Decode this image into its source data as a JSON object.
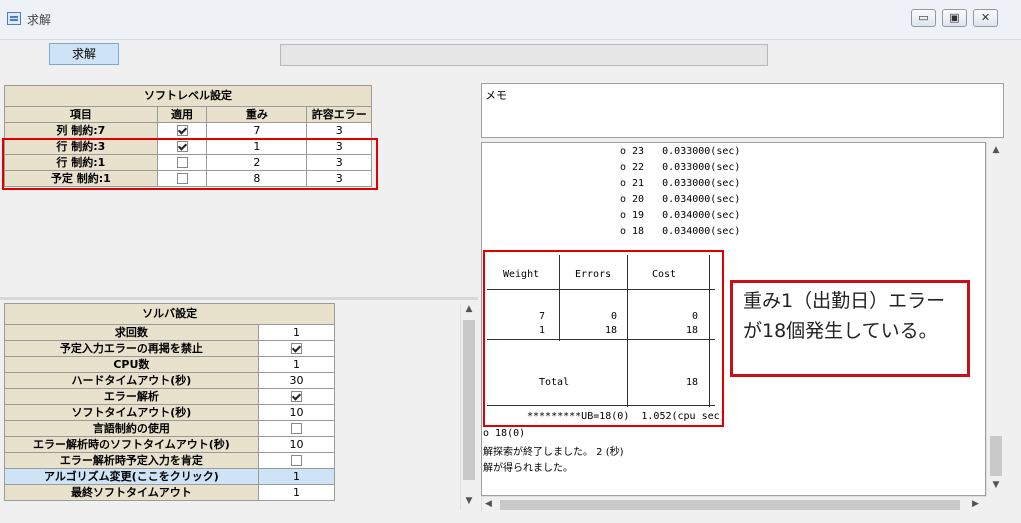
{
  "window": {
    "title": "求解",
    "minimize": "▭",
    "maximize": "▣",
    "close": "✕"
  },
  "toolbar": {
    "solve_label": "求解"
  },
  "soft_level": {
    "title": "ソフトレベル設定",
    "columns": [
      "項目",
      "適用",
      "重み",
      "許容エラー"
    ],
    "rows": [
      {
        "name": "列 制約:7",
        "applied": true,
        "weight": "7",
        "allowed": "3"
      },
      {
        "name": "行 制約:3",
        "applied": true,
        "weight": "1",
        "allowed": "3"
      },
      {
        "name": "行 制約:1",
        "applied": false,
        "weight": "2",
        "allowed": "3"
      },
      {
        "name": "予定 制約:1",
        "applied": false,
        "weight": "8",
        "allowed": "3"
      }
    ]
  },
  "solver": {
    "title": "ソルバ設定",
    "rows": [
      {
        "name": "求回数",
        "value": "1",
        "type": "text"
      },
      {
        "name": "予定入力エラーの再掲を禁止",
        "value": true,
        "type": "check"
      },
      {
        "name": "CPU数",
        "value": "1",
        "type": "text"
      },
      {
        "name": "ハードタイムアウト(秒)",
        "value": "30",
        "type": "text"
      },
      {
        "name": "エラー解析",
        "value": true,
        "type": "check"
      },
      {
        "name": "ソフトタイムアウト(秒)",
        "value": "10",
        "type": "text"
      },
      {
        "name": "言語制約の使用",
        "value": false,
        "type": "check"
      },
      {
        "name": "エラー解析時のソフトタイムアウト(秒)",
        "value": "10",
        "type": "text"
      },
      {
        "name": "エラー解析時予定入力を肯定",
        "value": false,
        "type": "check"
      },
      {
        "name": "アルゴリズム変更(ここをクリック)",
        "value": "1",
        "type": "text",
        "highlight": true
      },
      {
        "name": "最終ソフトタイムアウト",
        "value": "1",
        "type": "text"
      }
    ]
  },
  "memo": {
    "label": "メモ"
  },
  "log": {
    "lines": [
      "o 23   0.033000(sec)",
      "o 22   0.033000(sec)",
      "o 21   0.033000(sec)",
      "o 20   0.034000(sec)",
      "o 19   0.034000(sec)",
      "o 18   0.034000(sec)"
    ],
    "table": {
      "headers": [
        "Weight",
        "Errors",
        "Cost"
      ],
      "rows": [
        [
          "7",
          "0",
          "0"
        ],
        [
          "1",
          "18",
          "18"
        ]
      ],
      "total_label": "Total",
      "total_value": "18"
    },
    "summary": "*********UB=18(0)  1.052(cpu sec)",
    "tail": [
      "o 18(0)",
      "解探索が終了しました。 2 (秒)",
      "解が得られました。"
    ]
  },
  "callout": {
    "text": "重み1（出勤日）エラーが18個発生している。"
  },
  "colors": {
    "highlight_red": "#e00000",
    "header_beige": "#e8e2cc",
    "selected_row": "#cfe3f6"
  }
}
